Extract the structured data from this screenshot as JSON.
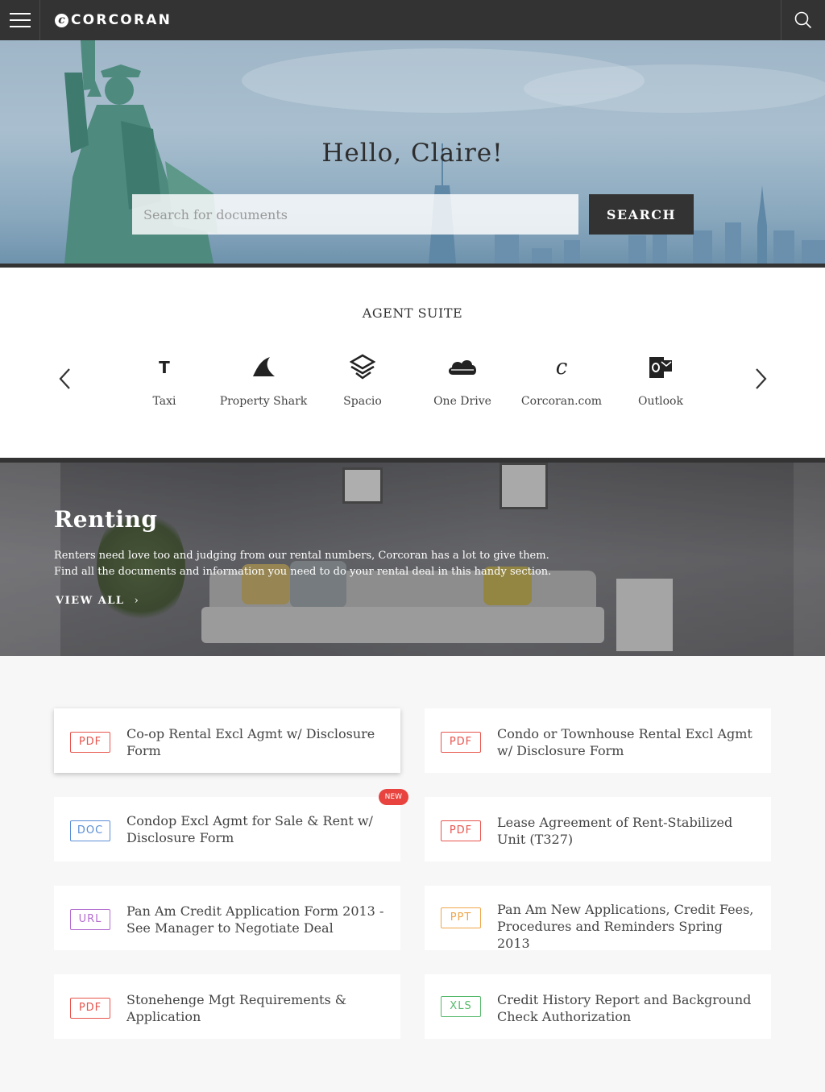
{
  "header": {
    "logo_mark": "c",
    "logo_text": "CORCORAN"
  },
  "hero": {
    "greeting": "Hello, Claire!",
    "search_placeholder": "Search for documents",
    "search_button": "SEARCH"
  },
  "agent_suite": {
    "title": "AGENT SUITE",
    "apps": [
      {
        "label": "Taxi",
        "icon": "taxi-icon"
      },
      {
        "label": "Property Shark",
        "icon": "shark-fin-icon"
      },
      {
        "label": "Spacio",
        "icon": "spacio-icon"
      },
      {
        "label": "One Drive",
        "icon": "cloud-icon"
      },
      {
        "label": "Corcoran.com",
        "icon": "corcoran-c-icon"
      },
      {
        "label": "Outlook",
        "icon": "outlook-icon"
      }
    ]
  },
  "renting": {
    "title": "Renting",
    "description_line1": "Renters need love too and judging from our rental numbers, Corcoran has a lot to give them.",
    "description_line2": "Find all the documents and information you need to do your rental deal in this handy section.",
    "view_all": "VIEW ALL",
    "view_all_chevron": "›"
  },
  "documents": [
    {
      "type": "PDF",
      "title": "Co-op Rental Excl Agmt w/ Disclosure Form",
      "new": false
    },
    {
      "type": "PDF",
      "title": "Condo or Townhouse Rental Excl Agmt w/ Disclosure Form",
      "new": false
    },
    {
      "type": "DOC",
      "title": "Condop Excl Agmt for Sale & Rent w/ Disclosure Form",
      "new": true,
      "new_label": "NEW"
    },
    {
      "type": "PDF",
      "title": "Lease Agreement of Rent-Stabilized Unit (T327)",
      "new": false
    },
    {
      "type": "URL",
      "title": "Pan Am Credit Application Form 2013 - See Manager to Negotiate Deal",
      "new": false
    },
    {
      "type": "PPT",
      "title": "Pan Am New Applications, Credit Fees, Procedures and Reminders Spring 2013",
      "new": false
    },
    {
      "type": "PDF",
      "title": "Stonehenge Mgt Requirements & Application",
      "new": false
    },
    {
      "type": "XLS",
      "title": "Credit History Report and Background Check Authorization",
      "new": false
    }
  ],
  "badge_colors": {
    "PDF": "#e8554e",
    "DOC": "#5b8fd6",
    "URL": "#b46ed0",
    "PPT": "#f0a64a",
    "XLS": "#55b96b"
  },
  "colors": {
    "topbar": "#333333",
    "accent_new": "#e8433e"
  }
}
